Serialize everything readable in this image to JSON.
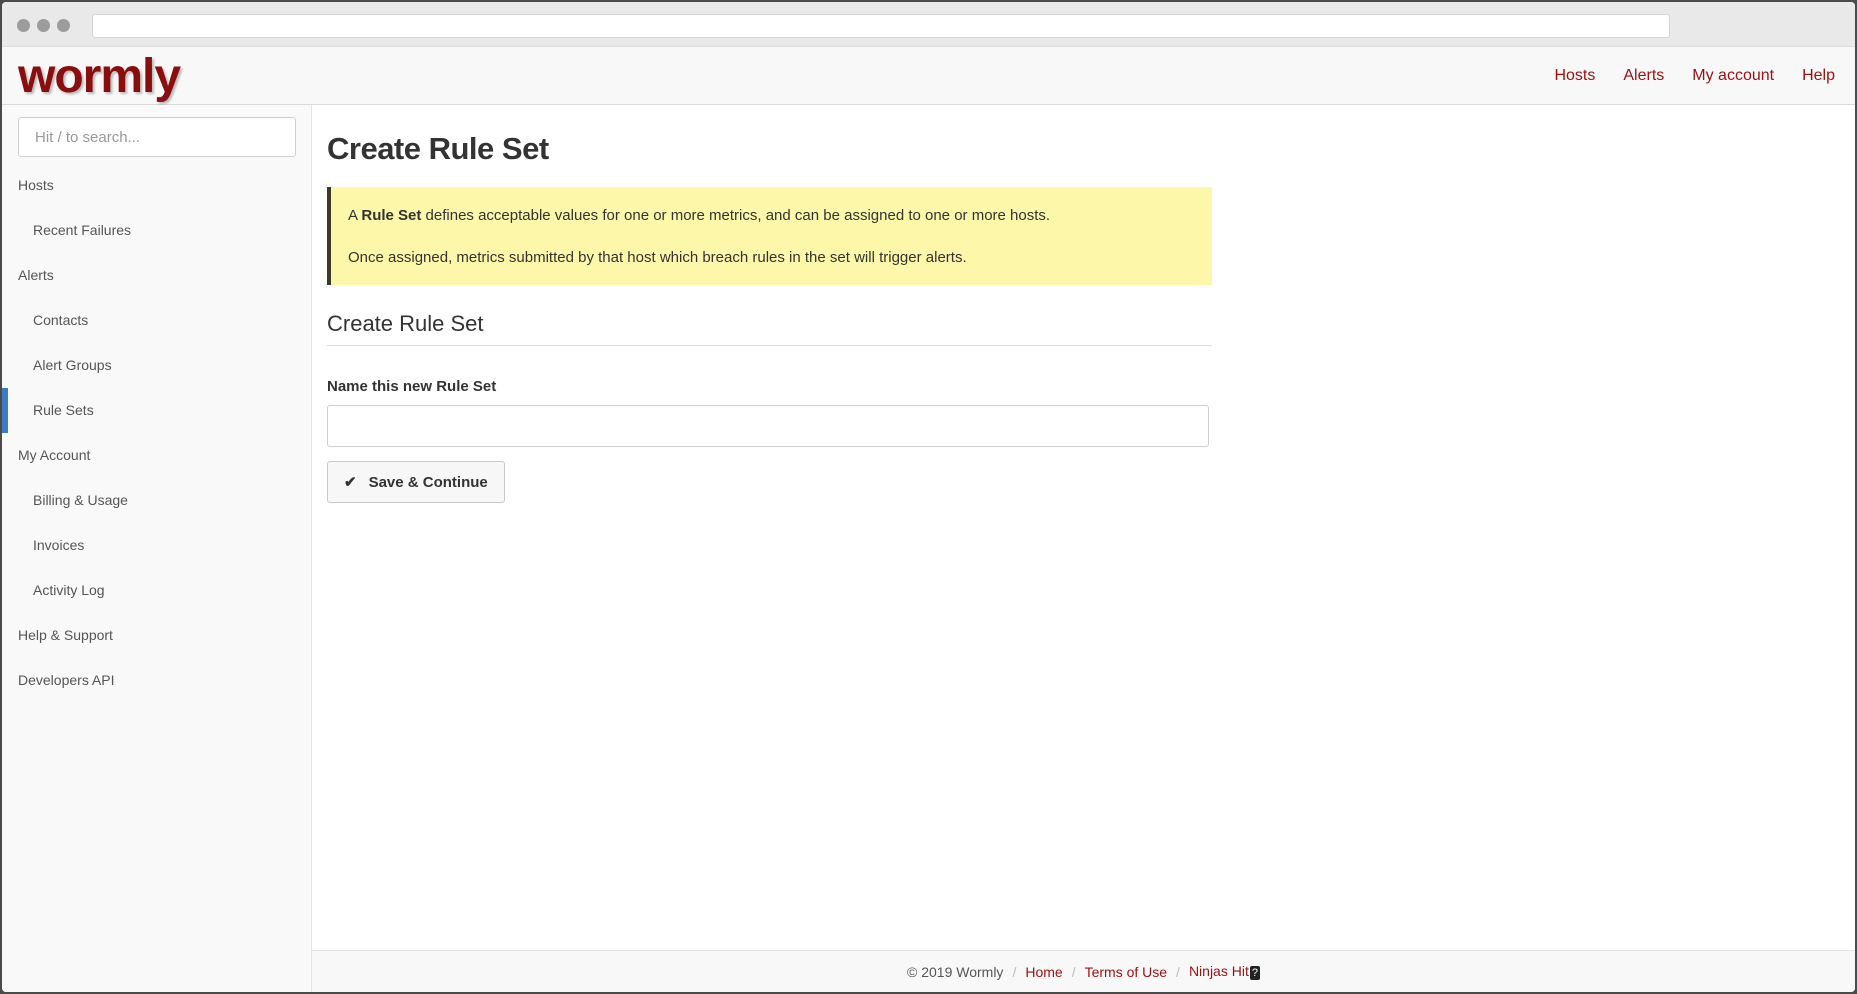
{
  "app": {
    "logo_text": "wormly",
    "brand_color": "#8b0e0e",
    "link_color": "#9b1111",
    "active_marker_color": "#3a7dc2"
  },
  "topnav": [
    {
      "label": "Hosts"
    },
    {
      "label": "Alerts"
    },
    {
      "label": "My account"
    },
    {
      "label": "Help"
    }
  ],
  "sidebar": {
    "search_placeholder": "Hit / to search...",
    "items": [
      {
        "label": "Hosts",
        "level": 0
      },
      {
        "label": "Recent Failures",
        "level": 1
      },
      {
        "label": "Alerts",
        "level": 0
      },
      {
        "label": "Contacts",
        "level": 1
      },
      {
        "label": "Alert Groups",
        "level": 1
      },
      {
        "label": "Rule Sets",
        "level": 1,
        "active": true
      },
      {
        "label": "My Account",
        "level": 0
      },
      {
        "label": "Billing & Usage",
        "level": 1
      },
      {
        "label": "Invoices",
        "level": 1
      },
      {
        "label": "Activity Log",
        "level": 1
      },
      {
        "label": "Help & Support",
        "level": 0
      },
      {
        "label": "Developers API",
        "level": 0
      }
    ]
  },
  "main": {
    "title": "Create Rule Set",
    "notice": {
      "line1_prefix": "A",
      "line1_bold": "Rule Set",
      "line1_suffix": "defines acceptable values for one or more metrics, and can be assigned to one or more hosts.",
      "line2": "Once assigned, metrics submitted by that host which breach rules in the set will trigger alerts."
    },
    "section_title": "Create Rule Set",
    "form": {
      "name_label": "Name this new Rule Set",
      "name_value": "",
      "save_label": "Save & Continue",
      "save_icon": "check-icon"
    }
  },
  "footer": {
    "copyright": "© 2019 Wormly",
    "links": [
      {
        "label": "Home"
      },
      {
        "label": "Terms of Use"
      },
      {
        "label": "Ninjas Hit"
      }
    ],
    "kbd": "?"
  }
}
